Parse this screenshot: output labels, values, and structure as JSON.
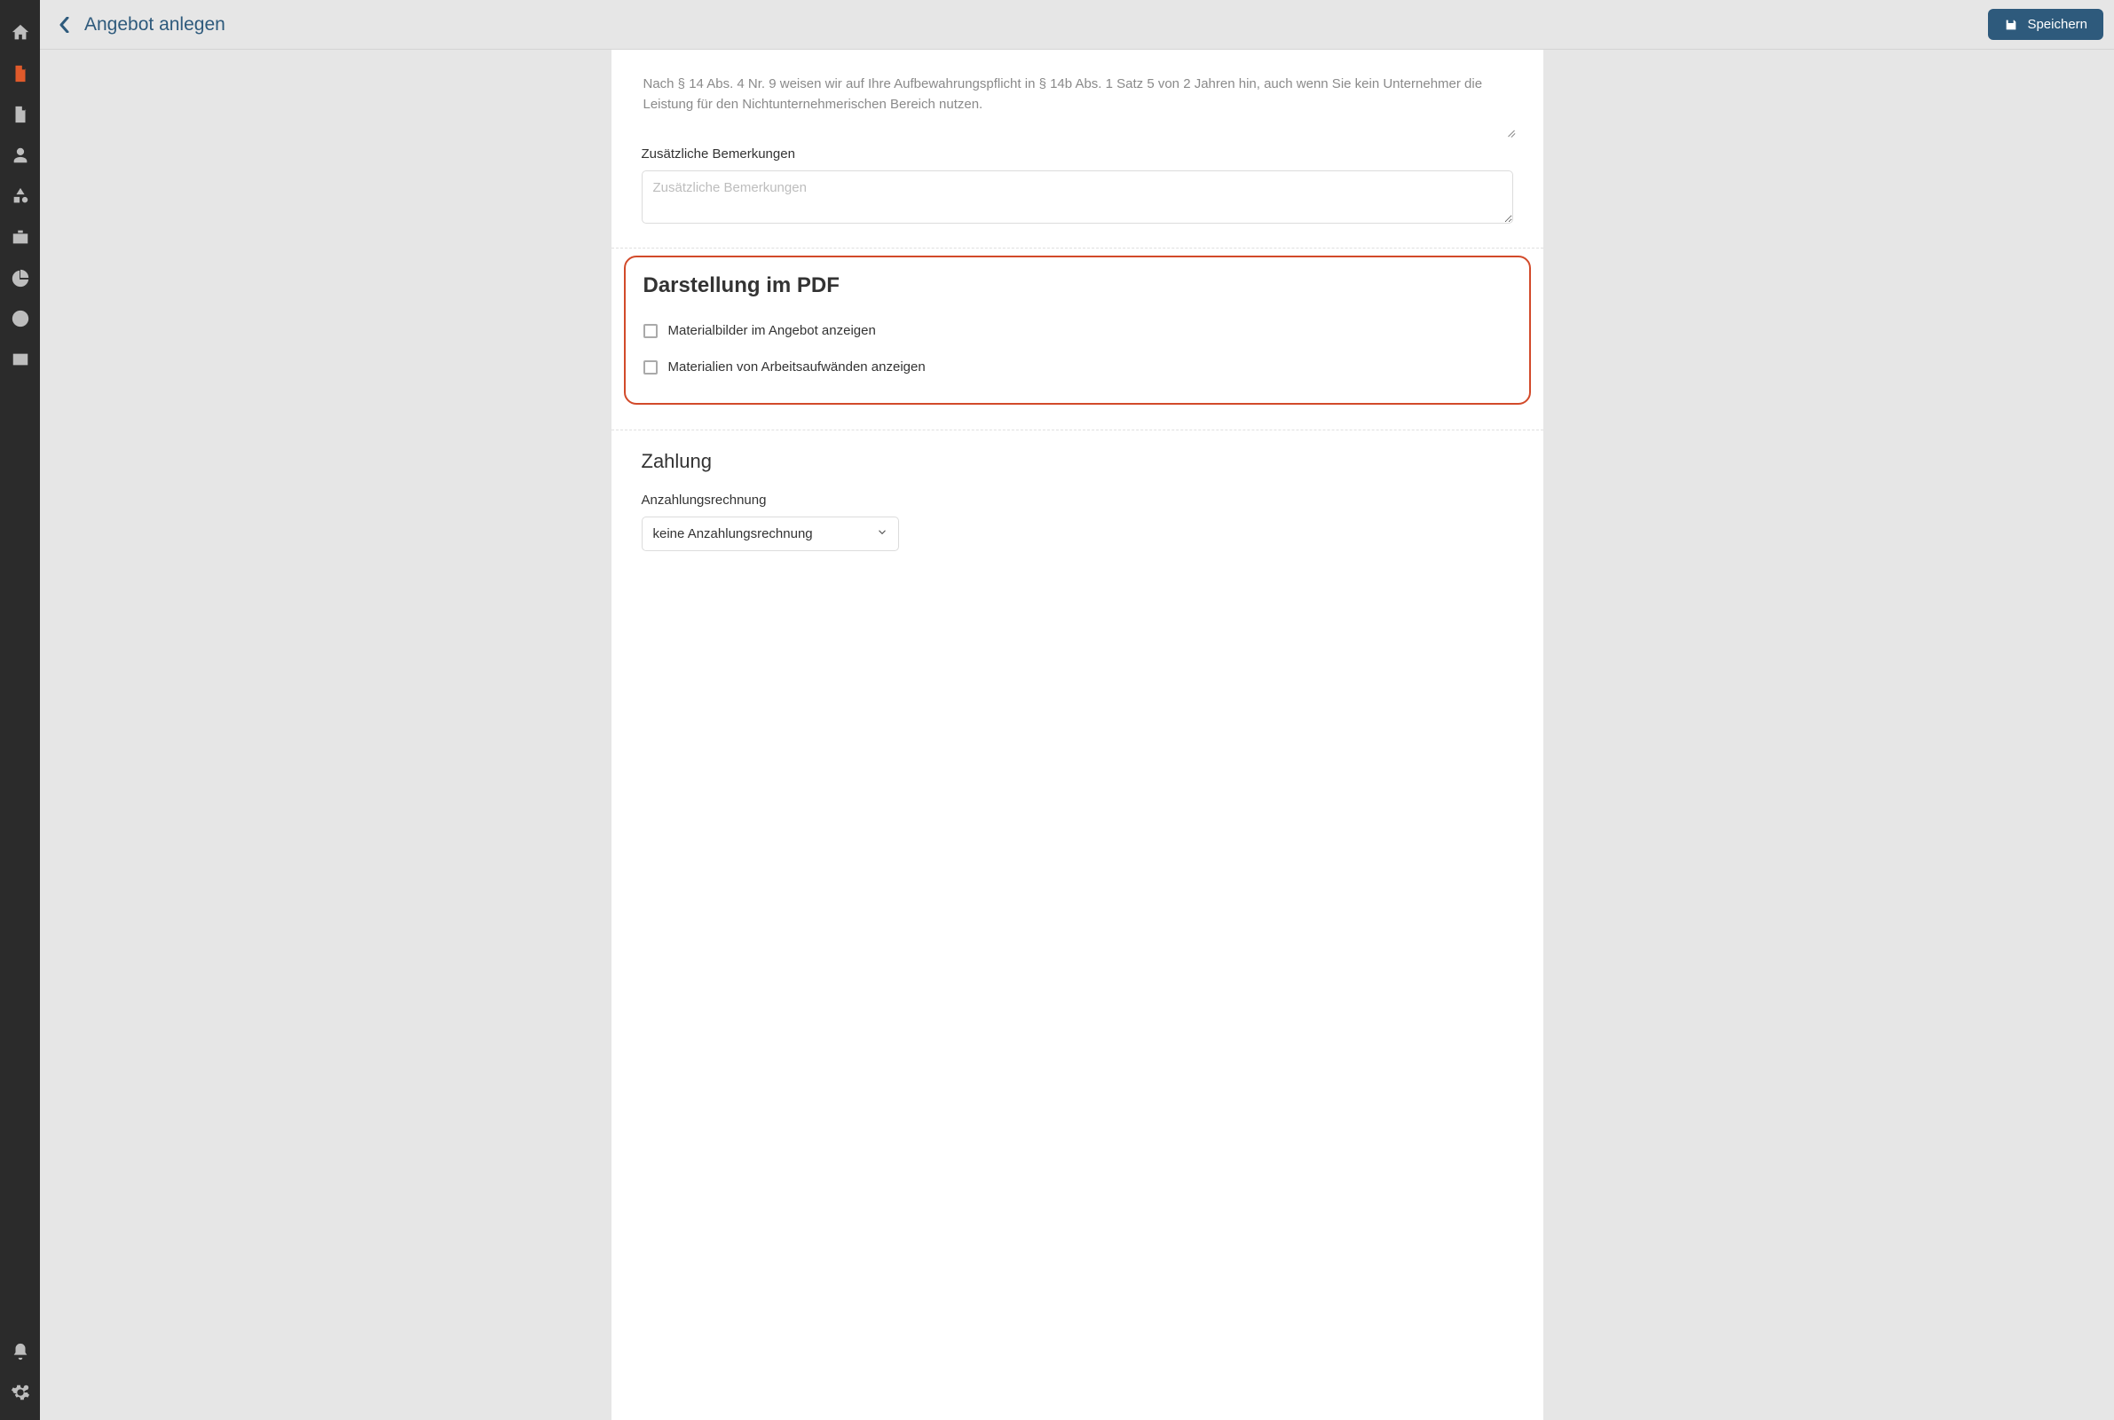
{
  "header": {
    "title": "Angebot anlegen",
    "save_label": "Speichern"
  },
  "note_text": "Nach § 14 Abs. 4 Nr. 9 weisen wir auf Ihre Aufbewahrungspflicht in § 14b Abs. 1 Satz 5 von 2 Jahren hin, auch wenn Sie kein Unternehmer die Leistung für den Nichtunternehmerischen Bereich nutzen.",
  "remarks": {
    "label": "Zusätzliche Bemerkungen",
    "placeholder": "Zusätzliche Bemerkungen",
    "value": ""
  },
  "pdf_section": {
    "title": "Darstellung im PDF",
    "checkbox_show_material_images": "Materialbilder im Angebot anzeigen",
    "checkbox_show_labor_materials": "Materialien von Arbeitsaufwänden anzeigen"
  },
  "payment_section": {
    "title": "Zahlung",
    "deposit_label": "Anzahlungsrechnung",
    "deposit_value": "keine Anzahlungsrechnung"
  },
  "sidebar_icons": [
    "home-icon",
    "document-icon",
    "invoice-icon",
    "person-icon",
    "shapes-icon",
    "toolbox-icon",
    "pie-chart-icon",
    "clock-icon",
    "id-card-icon"
  ],
  "sidebar_bottom_icons": [
    "bell-icon",
    "gear-icon"
  ]
}
